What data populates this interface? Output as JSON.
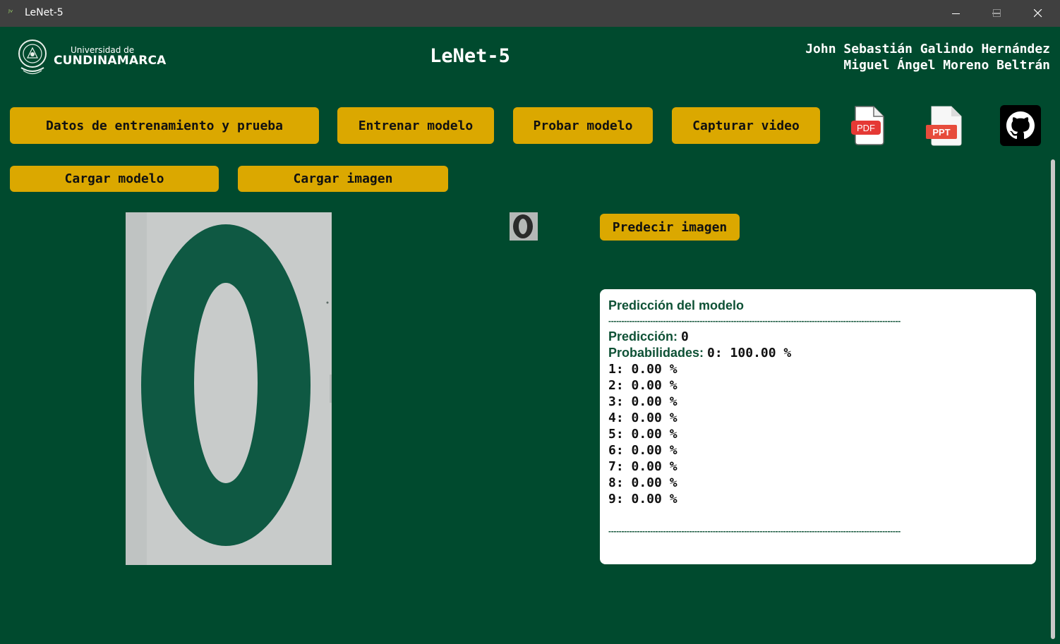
{
  "window": {
    "title": "LeNet-5"
  },
  "header": {
    "logo_line1": "Universidad de",
    "logo_line2": "CUNDINAMARCA",
    "title": "LeNet-5",
    "authors": [
      "John Sebastián Galindo Hernández",
      "Miguel Ángel Moreno Beltrán"
    ]
  },
  "toolbar": {
    "training_data": "Datos de entrenamiento y prueba",
    "train_model": "Entrenar modelo",
    "test_model": "Probar modelo",
    "capture_video": "Capturar video",
    "pdf_label": "PDF",
    "ppt_label": "PPT",
    "load_model": "Cargar modelo",
    "load_image": "Cargar imagen",
    "predict_image": "Predecir imagen"
  },
  "prediction": {
    "title": "Predicción del modelo",
    "separator": "----------------------------------------------------------------------------------------------------------------",
    "prediction_label": "Predicción:",
    "prediction_value": "0",
    "probabilities_label": "Probabilidades:",
    "probabilities": [
      "0: 100.00 %",
      "1: 0.00 %",
      "2: 0.00 %",
      "3: 0.00 %",
      "4: 0.00 %",
      "5: 0.00 %",
      "6: 0.00 %",
      "7: 0.00 %",
      "8: 0.00 %",
      "9: 0.00 %"
    ]
  },
  "colors": {
    "background": "#004a2e",
    "button": "#dba800",
    "panel_text": "#0e5135",
    "digit": "#0f5943"
  }
}
